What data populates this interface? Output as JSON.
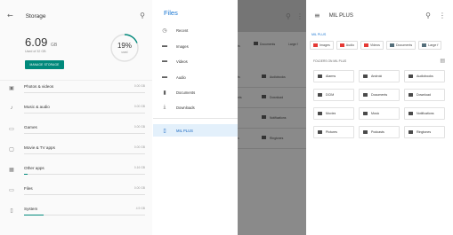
{
  "storage": {
    "title": "Storage",
    "used_value": "6.09",
    "used_unit": "GB",
    "used_of": "Used of 32 GB",
    "manage_button": "MANAGE STORAGE",
    "percent": "19%",
    "percent_sub": "used",
    "percent_value": 19,
    "categories": [
      {
        "label": "Photos & videos",
        "size": "0.00 GB",
        "fill": 0.0
      },
      {
        "label": "Music & audio",
        "size": "0.00 GB",
        "fill": 0.0
      },
      {
        "label": "Games",
        "size": "0.00 GB",
        "fill": 0.0
      },
      {
        "label": "Movie & TV apps",
        "size": "0.00 GB",
        "fill": 0.0
      },
      {
        "label": "Other apps",
        "size": "0.16 GB",
        "fill": 0.03
      },
      {
        "label": "Files",
        "size": "0.00 GB",
        "fill": 0.0
      },
      {
        "label": "System",
        "size": "4.9 GB",
        "fill": 0.16
      }
    ]
  },
  "files_drawer": {
    "title": "Files",
    "items": [
      {
        "label": "Recent",
        "icon": "clock-icon"
      },
      {
        "label": "Images",
        "icon": "image-icon"
      },
      {
        "label": "Videos",
        "icon": "video-icon"
      },
      {
        "label": "Audio",
        "icon": "audio-icon"
      },
      {
        "label": "Documents",
        "icon": "document-icon"
      },
      {
        "label": "Downloads",
        "icon": "download-icon"
      }
    ],
    "selected_item": {
      "label": "MIL PLUS",
      "icon": "phone-icon"
    },
    "behind": {
      "chips": [
        "Documents",
        "Large f"
      ],
      "folders": [
        "Audiobooks",
        "Download",
        "Notifications",
        "Ringtones"
      ]
    }
  },
  "milplus": {
    "title": "MIL PLUS",
    "breadcrumb": "MIL PLUS",
    "chips": [
      {
        "label": "Images",
        "color": "#e53935"
      },
      {
        "label": "Audio",
        "color": "#e53935"
      },
      {
        "label": "Videos",
        "color": "#e53935"
      },
      {
        "label": "Documents",
        "color": "#546e7a"
      },
      {
        "label": "Large f",
        "color": "#546e7a"
      }
    ],
    "section_label": "FOLDERS ON MIL PLUS",
    "folders": [
      "Alarms",
      "Android",
      "Audiobooks",
      "DCIM",
      "Documents",
      "Download",
      "Movies",
      "Music",
      "Notifications",
      "Pictures",
      "Podcasts",
      "Ringtones"
    ]
  },
  "colors": {
    "accent": "#00897b",
    "files_blue": "#1976d2"
  }
}
